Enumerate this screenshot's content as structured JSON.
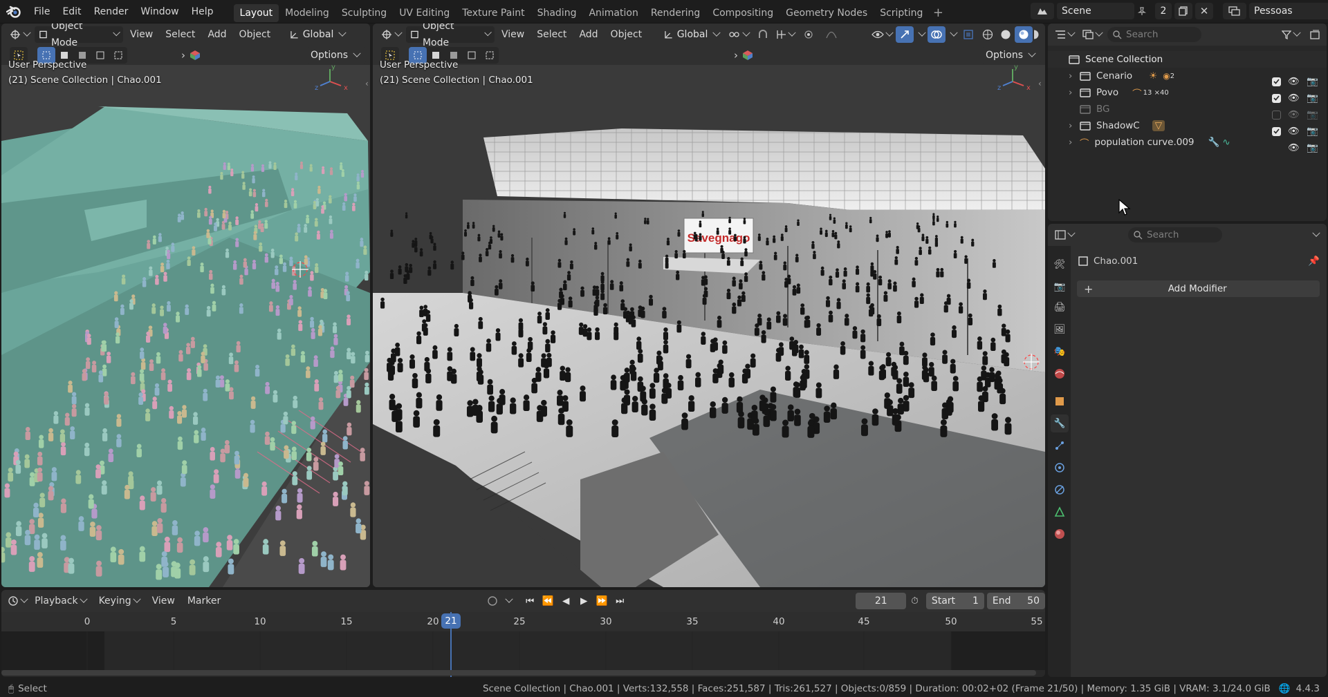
{
  "menu": {
    "file": "File",
    "edit": "Edit",
    "render": "Render",
    "window": "Window",
    "help": "Help"
  },
  "workspaces": [
    "Layout",
    "Modeling",
    "Sculpting",
    "UV Editing",
    "Texture Paint",
    "Shading",
    "Animation",
    "Rendering",
    "Compositing",
    "Geometry Nodes",
    "Scripting"
  ],
  "scene": {
    "name": "Scene",
    "users": "2",
    "view_layer": "Pessoas"
  },
  "viewport_left": {
    "mode": "Object Mode",
    "view": "View",
    "select": "Select",
    "add": "Add",
    "object": "Object",
    "orientation": "Global",
    "options": "Options",
    "perspective": "User Perspective",
    "info": "(21) Scene Collection | Chao.001"
  },
  "viewport_main": {
    "mode": "Object Mode",
    "view": "View",
    "select": "Select",
    "add": "Add",
    "object": "Object",
    "orientation": "Global",
    "options": "Options",
    "perspective": "User Perspective",
    "info": "(21) Scene Collection | Chao.001",
    "sign": "Savegnago"
  },
  "outliner": {
    "search_placeholder": "Search",
    "root": "Scene Collection",
    "items": [
      {
        "name": "Cenario",
        "extra": "2",
        "visible": true,
        "checked": true
      },
      {
        "name": "Povo",
        "extra": "13 ×40",
        "visible": true,
        "checked": true
      },
      {
        "name": "BG",
        "visible": false,
        "checked": false
      },
      {
        "name": "ShadowC",
        "visible": true,
        "checked": true
      },
      {
        "name": "population curve.009",
        "visible": true
      }
    ]
  },
  "properties": {
    "search_placeholder": "Search",
    "object_name": "Chao.001",
    "add_modifier": "Add Modifier"
  },
  "timeline": {
    "playback": "Playback",
    "keying": "Keying",
    "view": "View",
    "marker": "Marker",
    "current_frame": "21",
    "start_label": "Start",
    "start": "1",
    "end_label": "End",
    "end": "50",
    "ticks": [
      "0",
      "5",
      "10",
      "15",
      "20",
      "25",
      "30",
      "35",
      "40",
      "45",
      "50",
      "55"
    ]
  },
  "status": {
    "left": "Select",
    "stats": "Scene Collection | Chao.001 | Verts:132,558 | Faces:251,587 | Tris:261,527 | Objects:0/859 | Duration: 00:02+02 (Frame 21/50) | Memory: 1.35 GiB | VRAM: 3.1/24.0 GiB",
    "version": "4.4.3"
  },
  "colors": {
    "accent": "#4772b3",
    "frame_marker": "#4772b3",
    "teal_floor": "#6aa59a"
  }
}
